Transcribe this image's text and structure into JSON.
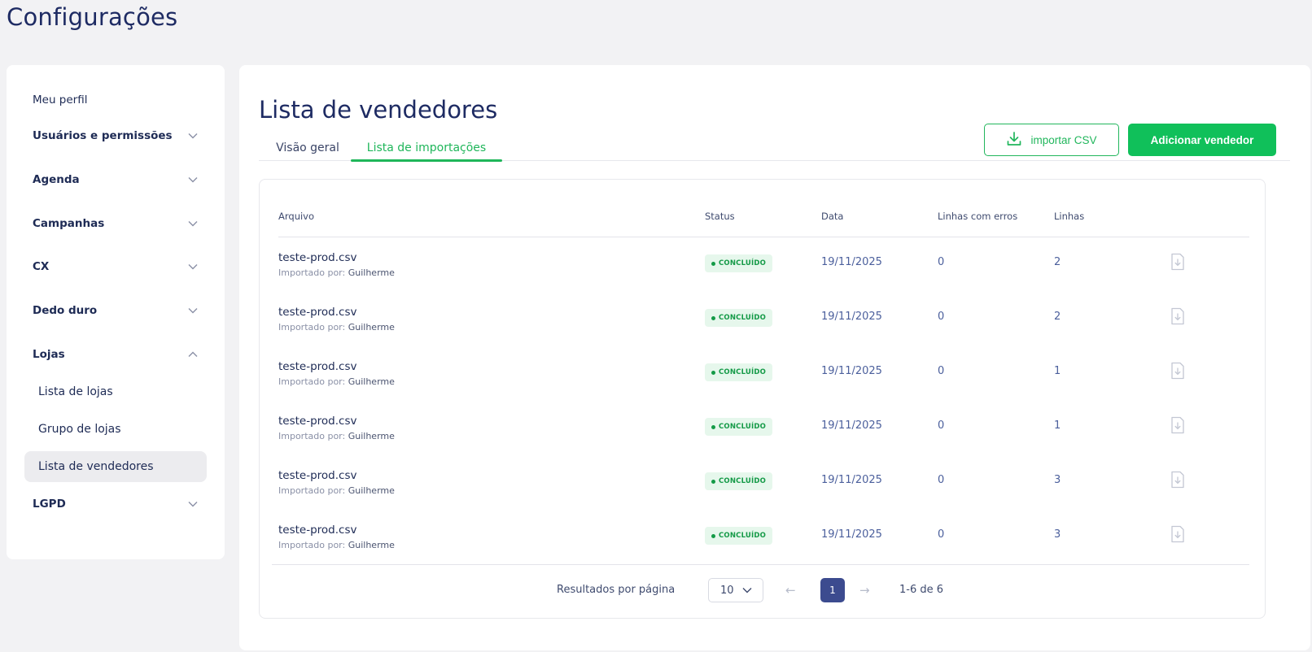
{
  "page": {
    "title": "Configurações"
  },
  "sidebar": {
    "items": [
      {
        "label": "Meu perfil",
        "chevron": "none"
      },
      {
        "label": "Usuários e permissões",
        "chevron": "down"
      },
      {
        "label": "Agenda",
        "chevron": "down"
      },
      {
        "label": "Campanhas",
        "chevron": "down"
      },
      {
        "label": "CX",
        "chevron": "down"
      },
      {
        "label": "Dedo duro",
        "chevron": "down"
      },
      {
        "label": "Lojas",
        "chevron": "up"
      },
      {
        "label": "Lista de lojas",
        "chevron": "none"
      },
      {
        "label": "Grupo de lojas",
        "chevron": "none"
      },
      {
        "label": "Lista de vendedores",
        "chevron": "none",
        "active": true
      },
      {
        "label": "LGPD",
        "chevron": "down"
      }
    ]
  },
  "main": {
    "title": "Lista de vendedores",
    "tabs": [
      {
        "label": "Visão geral",
        "active": false
      },
      {
        "label": "Lista de importações",
        "active": true
      }
    ],
    "import_button": {
      "label": "importar CSV",
      "icon": "download-icon"
    },
    "add_button": {
      "label": "Adicionar vendedor"
    }
  },
  "table": {
    "columns": [
      "Arquivo",
      "Status",
      "Data",
      "Linhas com erros",
      "Linhas"
    ],
    "rows": [
      {
        "file": "teste-prod.csv",
        "imported_by_label": "Importado por:",
        "imported_by": "Guilherme",
        "status": "CONCLUÍDO",
        "date": "19/11/2025",
        "error_lines": "0",
        "lines": "2"
      },
      {
        "file": "teste-prod.csv",
        "imported_by_label": "Importado por:",
        "imported_by": "Guilherme",
        "status": "CONCLUÍDO",
        "date": "19/11/2025",
        "error_lines": "0",
        "lines": "2"
      },
      {
        "file": "teste-prod.csv",
        "imported_by_label": "Importado por:",
        "imported_by": "Guilherme",
        "status": "CONCLUÍDO",
        "date": "19/11/2025",
        "error_lines": "0",
        "lines": "1"
      },
      {
        "file": "teste-prod.csv",
        "imported_by_label": "Importado por:",
        "imported_by": "Guilherme",
        "status": "CONCLUÍDO",
        "date": "19/11/2025",
        "error_lines": "0",
        "lines": "1"
      },
      {
        "file": "teste-prod.csv",
        "imported_by_label": "Importado por:",
        "imported_by": "Guilherme",
        "status": "CONCLUÍDO",
        "date": "19/11/2025",
        "error_lines": "0",
        "lines": "3"
      },
      {
        "file": "teste-prod.csv",
        "imported_by_label": "Importado por:",
        "imported_by": "Guilherme",
        "status": "CONCLUÍDO",
        "date": "19/11/2025",
        "error_lines": "0",
        "lines": "3"
      }
    ]
  },
  "pagination": {
    "per_page_label": "Resultados por página",
    "per_page_value": "10",
    "current_page": "1",
    "range": "1-6 de 6"
  },
  "colors": {
    "primary_green": "#10c05a",
    "navy": "#1e2b63",
    "badge_bg": "#e6f7ec",
    "pager_active": "#3c4b8f"
  }
}
